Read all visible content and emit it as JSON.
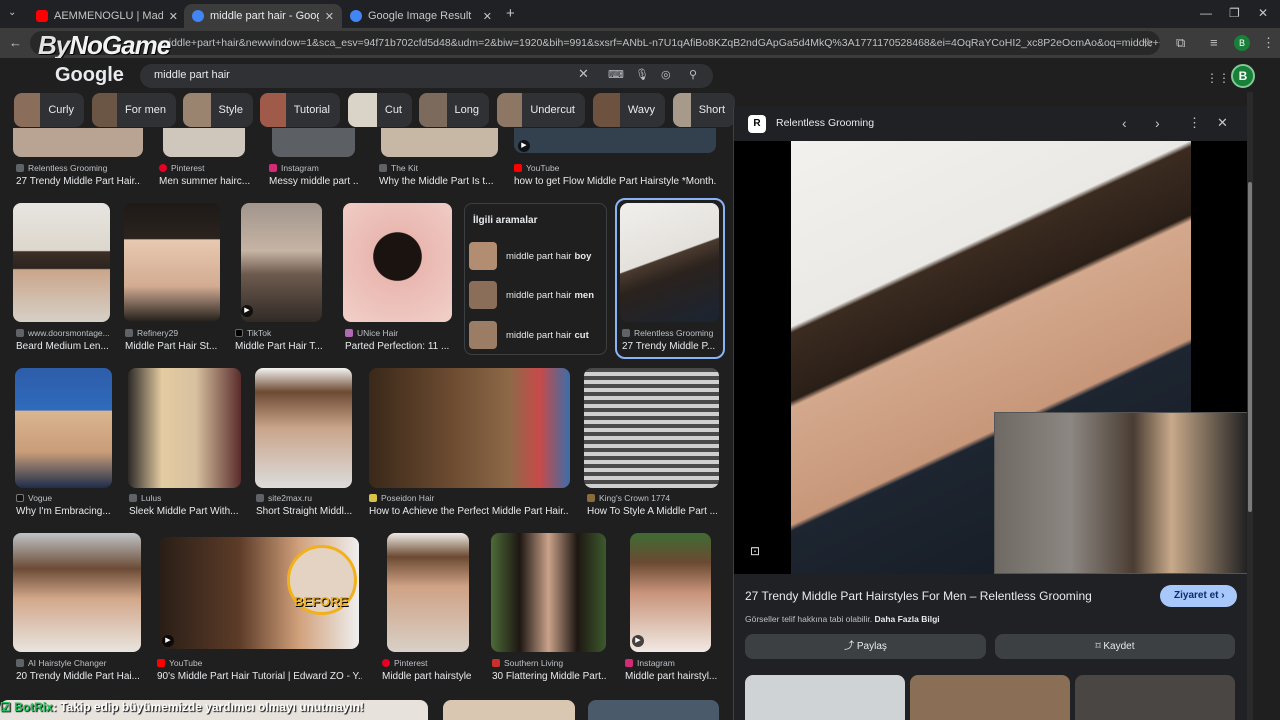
{
  "browser": {
    "tabs": [
      {
        "title": "AEMMENOGLU | Madara Olduk",
        "favicon_color": "#ff0000"
      },
      {
        "title": "middle part hair - Google'da Ar",
        "favicon_color": "#4285f4"
      },
      {
        "title": "Google Image Result",
        "favicon_color": "#4285f4"
      }
    ],
    "url": "middle+part+hair&newwindow=1&sca_esv=94f71b702cfd5d48&udm=2&biw=1920&bih=991&sxsrf=ANbL-n7U1qAfiBo8KZqB2ndGApGa5d4MkQ%3A1771170528468&ei=4OqRaYCoHI2_xc8P2eOcmAo&oq=middle++hair&g...",
    "avatar_letter": "B"
  },
  "watermark": {
    "by": "By",
    "rest": "NoGame"
  },
  "google": {
    "logo": "Google",
    "query": "middle part hair",
    "avatar_letter": "B"
  },
  "chips": [
    "Curly",
    "For men",
    "Style",
    "Tutorial",
    "Cut",
    "Long",
    "Undercut",
    "Wavy",
    "Short"
  ],
  "row1": [
    {
      "source": "Relentless Grooming",
      "caption": "27 Trendy Middle Part Hair..."
    },
    {
      "source": "Pinterest",
      "caption": "Men summer hairc..."
    },
    {
      "source": "Instagram",
      "caption": "Messy middle part ..."
    },
    {
      "source": "The Kit",
      "caption": "Why the Middle Part Is t..."
    },
    {
      "source": "YouTube",
      "caption": "how to get Flow Middle Part Hairstyle *Month..."
    }
  ],
  "row2": [
    {
      "source": "www.doorsmontage...",
      "caption": "Beard Medium Len..."
    },
    {
      "source": "Refinery29",
      "caption": "Middle Part Hair St..."
    },
    {
      "source": "TikTok",
      "caption": "Middle Part Hair T..."
    },
    {
      "source": "UNice Hair",
      "caption": "Parted Perfection: 11 ..."
    },
    {
      "source": "Relentless Grooming",
      "caption": "27 Trendy Middle P..."
    }
  ],
  "related": {
    "title": "İlgili aramalar",
    "items": [
      {
        "prefix": "middle part hair",
        "bold": "boy"
      },
      {
        "prefix": "middle part hair",
        "bold": "men"
      },
      {
        "prefix": "middle part hair",
        "bold": "cut"
      }
    ]
  },
  "row3": [
    {
      "source": "Vogue",
      "caption": "Why I'm Embracing..."
    },
    {
      "source": "Lulus",
      "caption": "Sleek Middle Part With..."
    },
    {
      "source": "site2max.ru",
      "caption": "Short Straight Middl..."
    },
    {
      "source": "Poseidon Hair",
      "caption": "How to Achieve the Perfect Middle Part Hair..."
    },
    {
      "source": "King's Crown 1774",
      "caption": "How To Style A Middle Part ..."
    }
  ],
  "row4": [
    {
      "source": "AI Hairstyle Changer",
      "caption": "20 Trendy Middle Part Hai..."
    },
    {
      "source": "YouTube",
      "caption": "90's Middle Part Hair Tutorial | Edward ZO - Y..."
    },
    {
      "source": "Pinterest",
      "caption": "Middle part hairstyle"
    },
    {
      "source": "Southern Living",
      "caption": "30 Flattering Middle Part..."
    },
    {
      "source": "Instagram",
      "caption": "Middle part hairstyl..."
    }
  ],
  "before_label": "BEFORE",
  "panel": {
    "site_name": "Relentless Grooming",
    "title": "27 Trendy Middle Part Hairstyles For Men – Relentless Grooming",
    "visit_label": "Ziyaret et",
    "copyright_note": "Görseller telif hakkına tabi olabilir.",
    "more_info": "Daha Fazla Bilgi",
    "share_label": "Paylaş",
    "save_label": "Kaydet"
  },
  "chat": {
    "name": "BotRix",
    "message": ": Takip edip büyümemizde yardımcı olmayı unutmayın!"
  },
  "colors": {
    "accent_blue": "#8ab4f8",
    "visit_button": "#a8c7fa",
    "selected_border": "#8ab4f8"
  }
}
